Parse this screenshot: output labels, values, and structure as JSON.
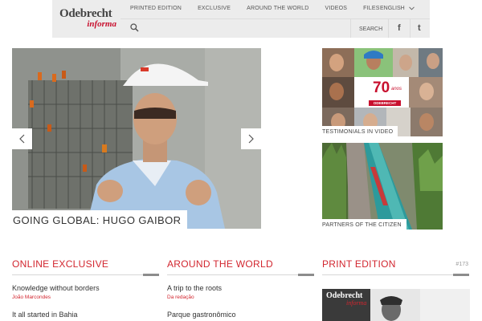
{
  "brand": {
    "name": "Odebrecht",
    "sub": "informa",
    "accent": "#d2262f"
  },
  "nav": {
    "items": [
      "PRINTED EDITION",
      "EXCLUSIVE",
      "AROUND THE WORLD",
      "VIDEOS",
      "FILES"
    ],
    "language": "ENGLISH",
    "search_label": "SEARCH",
    "social": [
      "f",
      "t"
    ]
  },
  "icons": [
    "search-icon",
    "chevron-down-icon",
    "facebook-icon",
    "twitter-icon",
    "arrow-left-icon",
    "arrow-right-icon"
  ],
  "hero": {
    "caption": "GOING GLOBAL: HUGO GAIBOR"
  },
  "sidebar": {
    "testimonials_caption": "TESTIMONIALS IN VIDEO",
    "badge_number": "70",
    "badge_label": "anos",
    "badge_brand": "ODEBRECHT",
    "partners_caption": "PARTNERS OF THE CITIZEN"
  },
  "sections": {
    "online": {
      "title": "ONLINE EXCLUSIVE",
      "articles": [
        {
          "title": "Knowledge without borders",
          "author": "João Marcondes"
        },
        {
          "title": "It all started in Bahia",
          "author": ""
        }
      ]
    },
    "world": {
      "title": "AROUND THE WORLD",
      "articles": [
        {
          "title": "A trip to the roots",
          "author": "Da redação"
        },
        {
          "title": "Parque gastronômico",
          "author": ""
        }
      ]
    },
    "print": {
      "title": "PRINT EDITION",
      "issue": "#173",
      "magazine_logo": "Odebrecht",
      "magazine_sub": "informa"
    }
  }
}
